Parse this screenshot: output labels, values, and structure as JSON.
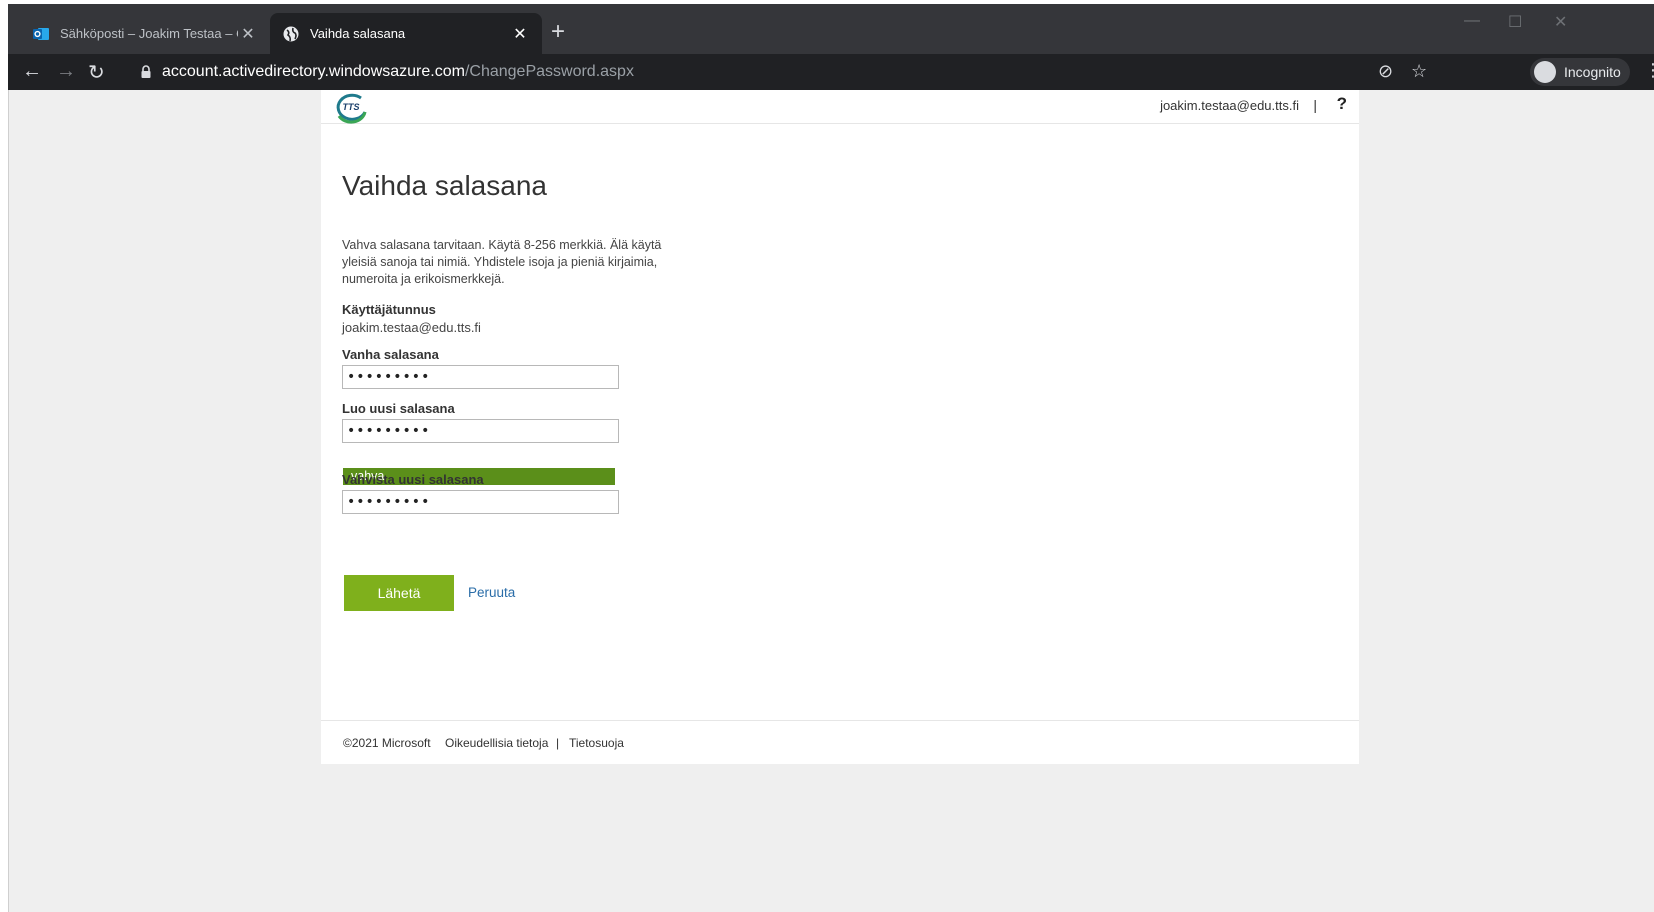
{
  "browser": {
    "tabs": [
      {
        "title": "Sähköposti – Joakim Testaa – Ou",
        "active": false
      },
      {
        "title": "Vaihda salasana",
        "active": true
      }
    ],
    "url_domain": "account.activedirectory.windowsazure.com",
    "url_path": "/ChangePassword.aspx",
    "incognito_label": "Incognito"
  },
  "header": {
    "user_email": "joakim.testaa@edu.tts.fi",
    "separator": "|",
    "help": "?"
  },
  "form": {
    "title": "Vaihda salasana",
    "description": "Vahva salasana tarvitaan. Käytä 8-256 merkkiä. Älä käytä yleisiä sanoja tai nimiä. Yhdistele isoja ja pieniä kirjaimia, numeroita ja erikoismerkkejä.",
    "username_label": "Käyttäjätunnus",
    "username_value": "joakim.testaa@edu.tts.fi",
    "old_password_label": "Vanha salasana",
    "old_password_value": "•••••••••",
    "new_password_label": "Luo uusi salasana",
    "new_password_value": "•••••••••",
    "strength_label": "vahva",
    "confirm_password_label": "Vahvista uusi salasana",
    "confirm_password_value": "•••••••••",
    "submit_label": "Lähetä",
    "cancel_label": "Peruuta"
  },
  "footer": {
    "copyright": "©2021 Microsoft",
    "legal": "Oikeudellisia tietoja",
    "separator": "|",
    "privacy": "Tietosuoja"
  },
  "colors": {
    "submit_button": "#7fb01c",
    "strength_bar": "#5b8f1a",
    "link": "#2a6da8"
  }
}
